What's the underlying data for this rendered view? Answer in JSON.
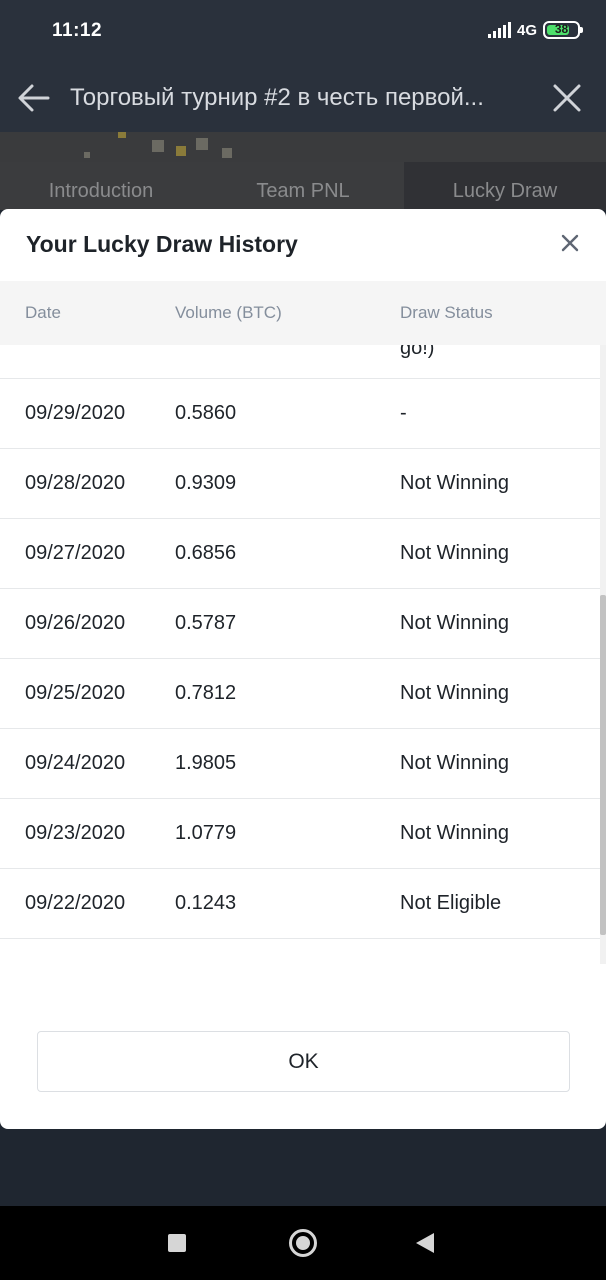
{
  "status_bar": {
    "time": "11:12",
    "network": "4G",
    "battery": "38"
  },
  "header": {
    "title": "Торговый турнир #2 в честь первой..."
  },
  "tabs": [
    {
      "label": "Introduction"
    },
    {
      "label": "Team PNL"
    },
    {
      "label": "Lucky Draw"
    }
  ],
  "modal": {
    "title": "Your Lucky Draw History",
    "columns": {
      "date": "Date",
      "volume": "Volume (BTC)",
      "status": "Draw Status"
    },
    "partial_status": "go!)",
    "rows": [
      {
        "date": "09/29/2020",
        "volume": "0.5860",
        "status": "-"
      },
      {
        "date": "09/28/2020",
        "volume": "0.9309",
        "status": "Not Winning"
      },
      {
        "date": "09/27/2020",
        "volume": "0.6856",
        "status": "Not Winning"
      },
      {
        "date": "09/26/2020",
        "volume": "0.5787",
        "status": "Not Winning"
      },
      {
        "date": "09/25/2020",
        "volume": "0.7812",
        "status": "Not Winning"
      },
      {
        "date": "09/24/2020",
        "volume": "1.9805",
        "status": "Not Winning"
      },
      {
        "date": "09/23/2020",
        "volume": "1.0779",
        "status": "Not Winning"
      },
      {
        "date": "09/22/2020",
        "volume": "0.1243",
        "status": "Not Eligible"
      }
    ],
    "ok_label": "OK"
  },
  "icons": {
    "back": "arrow-left-icon",
    "close": "close-icon",
    "nav_recents": "square-icon",
    "nav_home": "circle-icon",
    "nav_back": "triangle-back-icon"
  },
  "colors": {
    "header_bg": "#2a313c",
    "modal_bg": "#ffffff",
    "table_head_bg": "#f5f5f5",
    "text_primary": "#1e2329",
    "text_secondary": "#848e9c"
  }
}
